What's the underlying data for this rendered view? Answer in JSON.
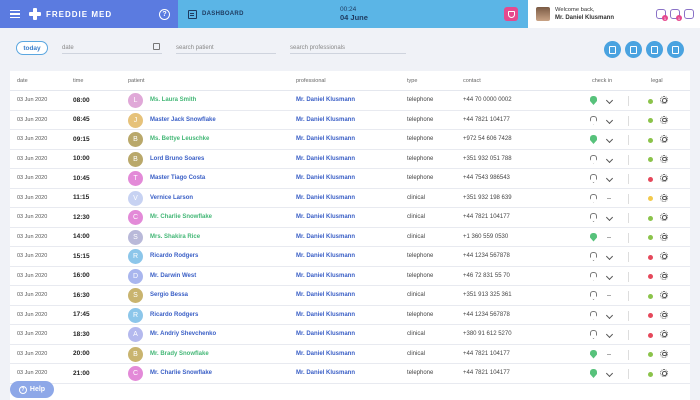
{
  "header": {
    "brand": "FREDDIE MED",
    "help_icon": "question-circle-icon",
    "section": "DASHBOARD",
    "clock_time": "00:24",
    "clock_date": "04 June",
    "welcome": "Welcome back,",
    "user": "Mr. Daniel Klusmann",
    "notif_counts": [
      "1",
      "1"
    ]
  },
  "filters": {
    "today": "today",
    "date_placeholder": "date",
    "patient_placeholder": "search patient",
    "professional_placeholder": "search professionals"
  },
  "columns": [
    "date",
    "time",
    "patient",
    "professional",
    "type",
    "contact",
    "check in",
    "legal"
  ],
  "colors": {
    "green": "#57c27b",
    "patient_green": "#43b776",
    "patient_blue": "#3a5fc6",
    "legal_green": "#8bc34a",
    "legal_red": "#e5485b",
    "legal_yellow": "#f2c94c"
  },
  "rows": [
    {
      "date": "03 Jun 2020",
      "time": "08:00",
      "initial": "L",
      "avatar": "#e0a8d8",
      "patient": "Ms. Laura Smith",
      "pcolor": "#43b776",
      "professional": "Mr. Daniel Klusmann",
      "type": "telephone",
      "contact": "+44 70 0000 0002",
      "checkin": true,
      "expand": true,
      "legal": "#8bc34a"
    },
    {
      "date": "03 Jun 2020",
      "time": "08:45",
      "initial": "J",
      "avatar": "#e6c27a",
      "patient": "Master Jack Snowflake",
      "pcolor": "#3a5fc6",
      "professional": "Mr. Daniel Klusmann",
      "type": "telephone",
      "contact": "+44 7821 104177",
      "checkin": false,
      "expand": true,
      "legal": "#8bc34a"
    },
    {
      "date": "03 Jun 2020",
      "time": "09:15",
      "initial": "B",
      "avatar": "#b9a86a",
      "patient": "Ms. Bettye Leuschke",
      "pcolor": "#43b776",
      "professional": "Mr. Daniel Klusmann",
      "type": "telephone",
      "contact": "+972 54 606 7428",
      "checkin": true,
      "expand": true,
      "legal": "#8bc34a"
    },
    {
      "date": "03 Jun 2020",
      "time": "10:00",
      "initial": "B",
      "avatar": "#b9a86a",
      "patient": "Lord Bruno Soares",
      "pcolor": "#3a5fc6",
      "professional": "Mr. Daniel Klusmann",
      "type": "telephone",
      "contact": "+351 932 051 788",
      "checkin": false,
      "expand": true,
      "legal": "#8bc34a"
    },
    {
      "date": "03 Jun 2020",
      "time": "10:45",
      "initial": "T",
      "avatar": "#e38ad8",
      "patient": "Master Tiago Costa",
      "pcolor": "#3a5fc6",
      "professional": "Mr. Daniel Klusmann",
      "type": "telephone",
      "contact": "+44 7543 986543",
      "checkin": false,
      "expand": true,
      "legal": "#e5485b"
    },
    {
      "date": "03 Jun 2020",
      "time": "11:15",
      "initial": "V",
      "avatar": "#c7d2f2",
      "patient": "Vernice Larson",
      "pcolor": "#3a5fc6",
      "professional": "Mr. Daniel Klusmann",
      "type": "clinical",
      "contact": "+351 932 198 639",
      "checkin": false,
      "expand": false,
      "legal": "#f2c94c"
    },
    {
      "date": "03 Jun 2020",
      "time": "12:30",
      "initial": "C",
      "avatar": "#e38ad8",
      "patient": "Mr. Charlie Snowflake",
      "pcolor": "#43b776",
      "professional": "Mr. Daniel Klusmann",
      "type": "clinical",
      "contact": "+44 7821 104177",
      "checkin": false,
      "expand": true,
      "legal": "#8bc34a"
    },
    {
      "date": "03 Jun 2020",
      "time": "14:00",
      "initial": "S",
      "avatar": "#b9b9d9",
      "patient": "Mrs. Shakira Rice",
      "pcolor": "#43b776",
      "professional": "Mr. Daniel Klusmann",
      "type": "clinical",
      "contact": "+1 360 559 0530",
      "checkin": true,
      "expand": false,
      "legal": "#8bc34a"
    },
    {
      "date": "03 Jun 2020",
      "time": "15:15",
      "initial": "R",
      "avatar": "#8cc6ea",
      "patient": "Ricardo Rodgers",
      "pcolor": "#3a5fc6",
      "professional": "Mr. Daniel Klusmann",
      "type": "telephone",
      "contact": "+44 1234 567878",
      "checkin": false,
      "expand": true,
      "legal": "#e5485b"
    },
    {
      "date": "03 Jun 2020",
      "time": "16:00",
      "initial": "D",
      "avatar": "#a9b6ee",
      "patient": "Mr. Darwin West",
      "pcolor": "#3a5fc6",
      "professional": "Mr. Daniel Klusmann",
      "type": "telephone",
      "contact": "+46 72 831 55 70",
      "checkin": false,
      "expand": true,
      "legal": "#e5485b"
    },
    {
      "date": "03 Jun 2020",
      "time": "16:30",
      "initial": "S",
      "avatar": "#c9b46f",
      "patient": "Sergio Bessa",
      "pcolor": "#3a5fc6",
      "professional": "Mr. Daniel Klusmann",
      "type": "clinical",
      "contact": "+351 913 325 361",
      "checkin": false,
      "expand": false,
      "legal": "#8bc34a"
    },
    {
      "date": "03 Jun 2020",
      "time": "17:45",
      "initial": "R",
      "avatar": "#8cc6ea",
      "patient": "Ricardo Rodgers",
      "pcolor": "#3a5fc6",
      "professional": "Mr. Daniel Klusmann",
      "type": "telephone",
      "contact": "+44 1234 567878",
      "checkin": false,
      "expand": true,
      "legal": "#e5485b"
    },
    {
      "date": "03 Jun 2020",
      "time": "18:30",
      "initial": "A",
      "avatar": "#b4b9ee",
      "patient": "Mr. Andriy Shevchenko",
      "pcolor": "#3a5fc6",
      "professional": "Mr. Daniel Klusmann",
      "type": "clinical",
      "contact": "+380 91 612 5270",
      "checkin": false,
      "expand": true,
      "legal": "#e5485b"
    },
    {
      "date": "03 Jun 2020",
      "time": "20:00",
      "initial": "B",
      "avatar": "#c9b46f",
      "patient": "Mr. Brady Snowflake",
      "pcolor": "#43b776",
      "professional": "Mr. Daniel Klusmann",
      "type": "clinical",
      "contact": "+44 7821 104177",
      "checkin": true,
      "expand": false,
      "legal": "#8bc34a"
    },
    {
      "date": "03 Jun 2020",
      "time": "21:00",
      "initial": "C",
      "avatar": "#e38ad8",
      "patient": "Mr. Charlie Snowflake",
      "pcolor": "#3a5fc6",
      "professional": "Mr. Daniel Klusmann",
      "type": "telephone",
      "contact": "+44 7821 104177",
      "checkin": true,
      "expand": true,
      "legal": "#8bc34a"
    }
  ],
  "help": "Help"
}
